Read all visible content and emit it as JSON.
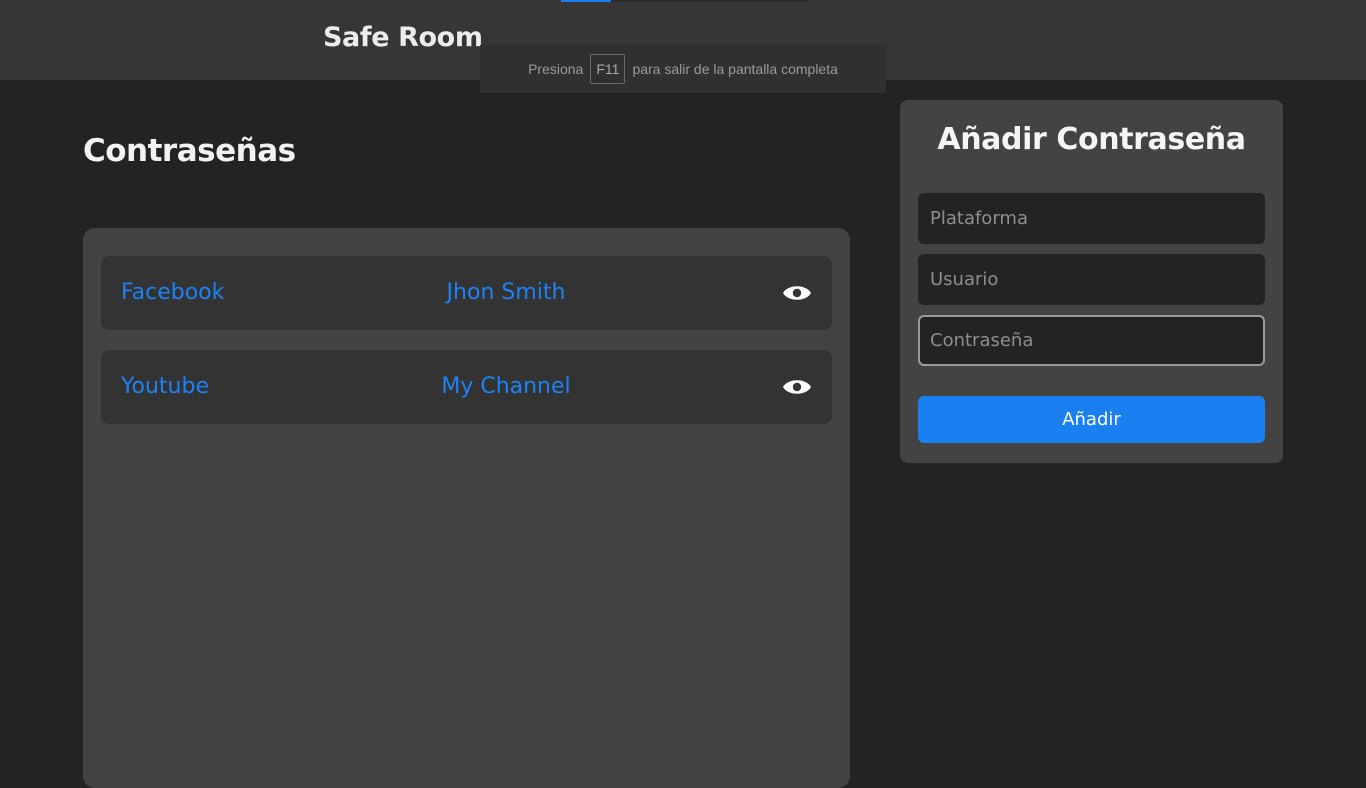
{
  "header": {
    "brand": "Safe Room",
    "fullscreen_notice": {
      "before": "Presiona",
      "key": "F11",
      "after": "para salir de la pantalla completa"
    }
  },
  "main": {
    "title": "Contraseñas",
    "entries": [
      {
        "platform": "Facebook",
        "user": "Jhon Smith",
        "icon": "eye-icon"
      },
      {
        "platform": "Youtube",
        "user": "My Channel",
        "icon": "eye-icon"
      }
    ]
  },
  "form": {
    "title": "Añadir Contraseña",
    "platform_placeholder": "Plataforma",
    "user_placeholder": "Usuario",
    "password_placeholder": "Contraseña",
    "platform_value": "",
    "user_value": "",
    "password_value": "",
    "submit_label": "Añadir"
  },
  "colors": {
    "background": "#232323",
    "header": "#363636",
    "panel": "#434343",
    "row": "#333333",
    "accent": "#1a7ff0",
    "link_text": "#1d82f5"
  }
}
